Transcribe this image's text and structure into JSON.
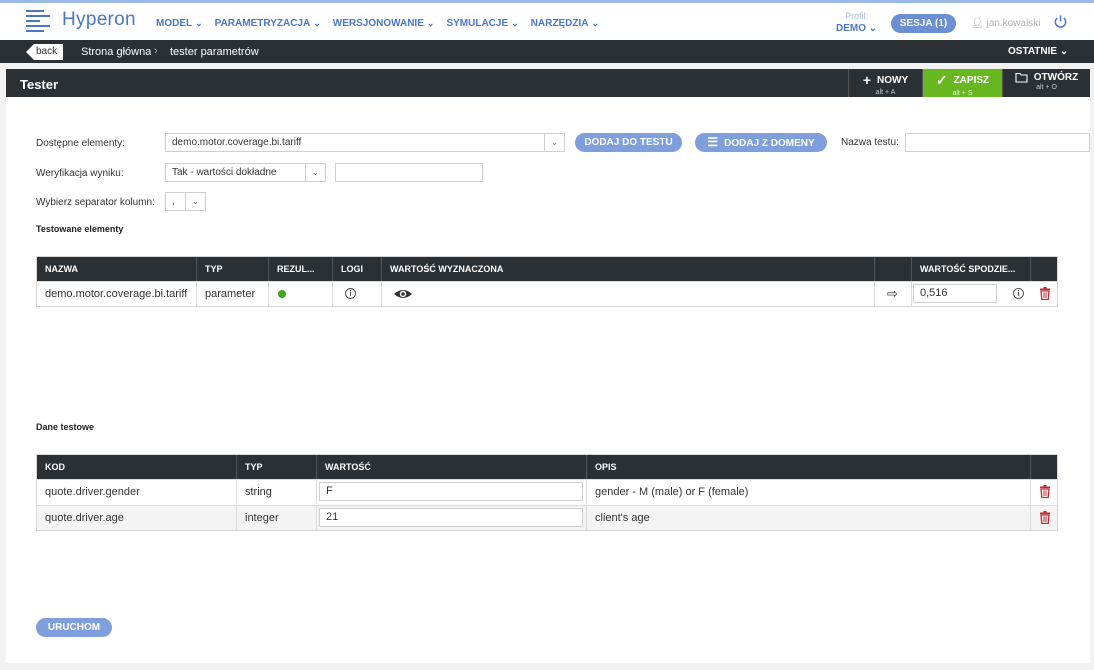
{
  "app": {
    "logo_text": "Hyperon"
  },
  "menu": [
    {
      "label": "MODEL"
    },
    {
      "label": "PARAMETRYZACJA"
    },
    {
      "label": "WERSJONOWANIE"
    },
    {
      "label": "SYMULACJE"
    },
    {
      "label": "NARZĘDZIA"
    }
  ],
  "profile": {
    "label": "Profil:",
    "value": "DEMO"
  },
  "session": {
    "label": "SESJA (1)"
  },
  "user": {
    "name": "jan.kowalski"
  },
  "breadcrumb": {
    "back_label": "back",
    "items": [
      "Strona główna",
      "tester parametrów"
    ],
    "recent_label": "OSTATNIE"
  },
  "panel": {
    "title": "Tester",
    "toolbar": {
      "new": {
        "label": "NOWY",
        "shortcut": "alt + A"
      },
      "save": {
        "label": "ZAPISZ",
        "shortcut": "alt + S"
      },
      "open": {
        "label": "OTWÓRZ",
        "shortcut": "alt + O"
      }
    }
  },
  "form": {
    "available_label": "Dostępne elementy:",
    "available_value": "demo.motor.coverage.bi.tariff",
    "add_to_test_label": "DODAJ DO TESTU",
    "add_from_domain_label": "DODAJ Z DOMENY",
    "test_name_label": "Nazwa testu:",
    "test_name_value": "",
    "verification_label": "Weryfikacja wyniku:",
    "verification_value": "Tak - wartości dokładne",
    "verification_extra_value": "",
    "separator_label": "Wybierz separator kolumn:",
    "separator_value": ","
  },
  "tested": {
    "section_label": "Testowane elementy",
    "columns": {
      "name": "NAZWA",
      "type": "TYP",
      "result": "REZUL...",
      "logs": "LOGI",
      "computed": "WARTOŚĆ WYZNACZONA",
      "expected": "WARTOŚĆ SPODZIE..."
    },
    "rows": [
      {
        "name": "demo.motor.coverage.bi.tariff",
        "type": "parameter",
        "result_color": "#3ea31f",
        "expected": "0,516"
      }
    ]
  },
  "testdata": {
    "section_label": "Dane testowe",
    "columns": {
      "code": "KOD",
      "type": "TYP",
      "value": "WARTOŚĆ",
      "desc": "OPIS"
    },
    "rows": [
      {
        "code": "quote.driver.gender",
        "type": "string",
        "value": "F",
        "desc": "gender - M (male) or F (female)"
      },
      {
        "code": "quote.driver.age",
        "type": "integer",
        "value": "21",
        "desc": "client's age"
      }
    ]
  },
  "run_label": "URUCHOM"
}
